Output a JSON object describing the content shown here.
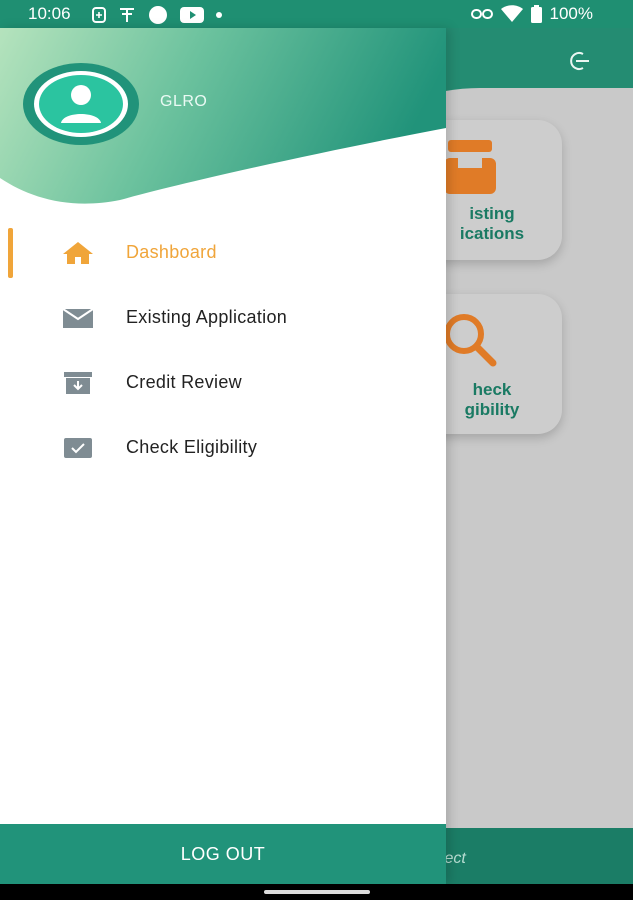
{
  "status_bar": {
    "time": "10:06",
    "battery": "100%"
  },
  "background_app": {
    "cards": [
      {
        "label_line1": "isting",
        "label_line2": "ications",
        "icon": "inbox-tray-icon"
      },
      {
        "label_line1": "heck",
        "label_line2": "gibility",
        "icon": "search-icon"
      }
    ],
    "tagline": "fect",
    "accent_color": "#e07b27"
  },
  "drawer": {
    "username": "GLRO",
    "menu": [
      {
        "label": "Dashboard",
        "icon": "home-icon",
        "active": true
      },
      {
        "label": "Existing Application",
        "icon": "mail-icon",
        "active": false
      },
      {
        "label": "Credit Review",
        "icon": "archive-download-icon",
        "active": false
      },
      {
        "label": "Check Eligibility",
        "icon": "checkbox-icon",
        "active": false
      }
    ],
    "logout_label": "LOG OUT"
  },
  "colors": {
    "primary": "#21937a",
    "active": "#f0a53a",
    "icon_gray": "#7f8c93"
  }
}
